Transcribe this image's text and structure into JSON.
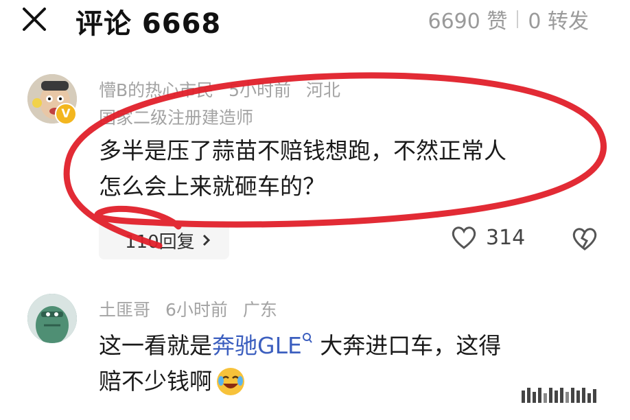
{
  "header": {
    "title": "评论 6668",
    "likes": "6690 赞",
    "shares": "0 转发"
  },
  "comments": [
    {
      "username": "懵B的热心市民",
      "time": "5小时前",
      "location": "河北",
      "badge_title": "国家二级注册建造师",
      "text_line1": "多半是压了蒜苗不赔钱想跑，不然正常人",
      "text_line2": "怎么会上来就砸车的？",
      "reply_label": "110回复",
      "like_count": "314",
      "verified_badge": "V"
    },
    {
      "username": "土匪哥",
      "time": "6小时前",
      "location": "广东",
      "text_part1": "这一看就是",
      "link_text": "奔驰GLE",
      "text_part2": " 大奔进口车，这得",
      "text_line2": "赔不少钱啊"
    }
  ],
  "icons": [
    "close-icon",
    "heart-icon",
    "broken-heart-icon",
    "search-icon",
    "laugh-cry-emoji",
    "chevron-right-icon"
  ],
  "colors": {
    "annotation": "#e0202a",
    "link": "#3c5fbf",
    "meta": "#a3a3a3",
    "badge": "#f3b61f"
  }
}
